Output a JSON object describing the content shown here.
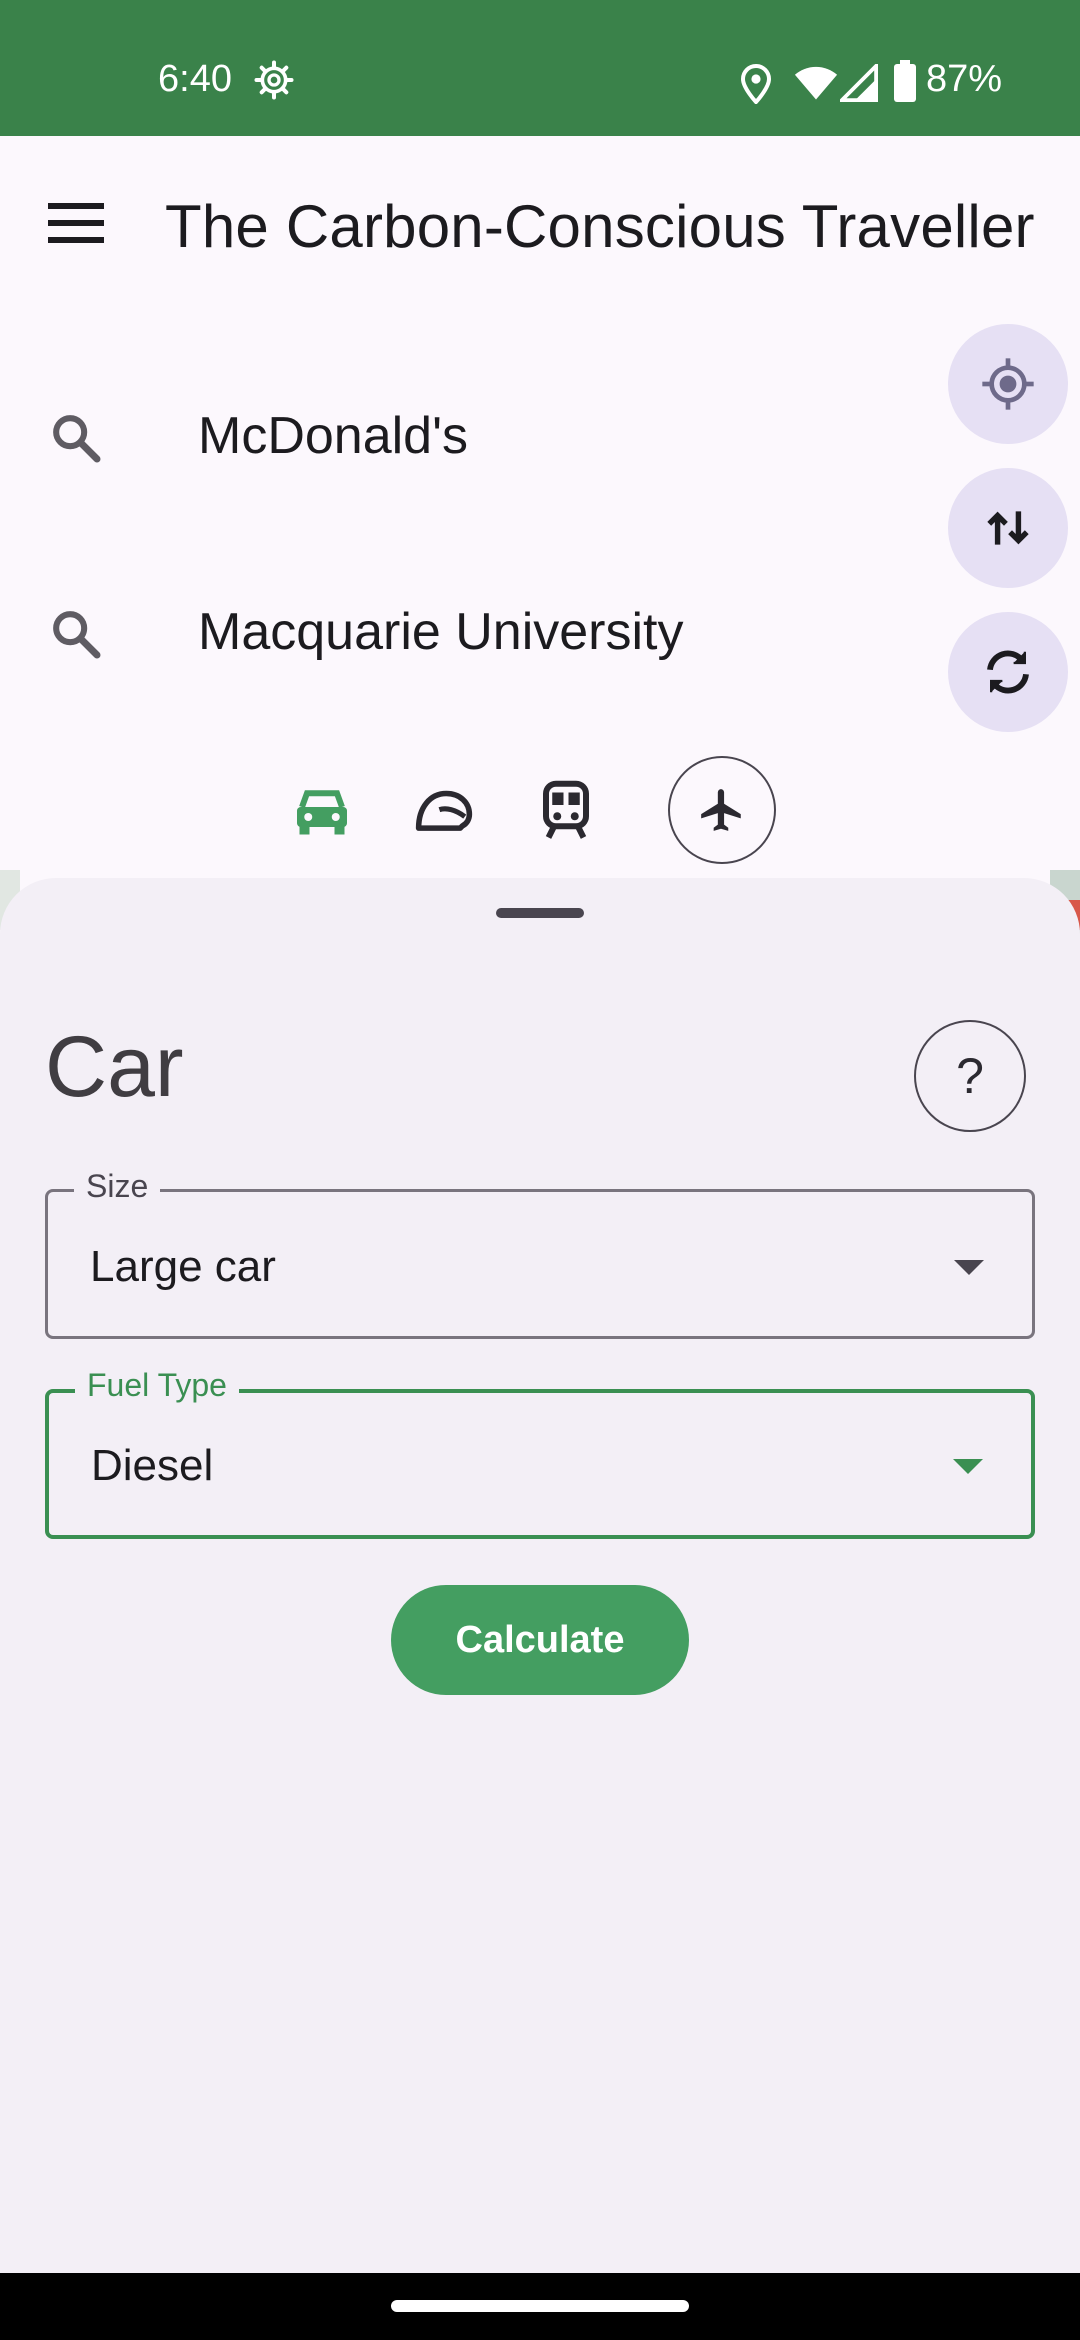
{
  "status_bar": {
    "time": "6:40",
    "battery": "87%",
    "icons": [
      "settings-gear-icon",
      "location-icon",
      "wifi-icon",
      "cell-signal-icon",
      "battery-icon"
    ]
  },
  "app_bar": {
    "title": "The Carbon-Conscious Traveller",
    "menu_icon": "hamburger-menu-icon"
  },
  "search": {
    "origin": "McDonald's",
    "destination": "Macquarie University"
  },
  "fabs": [
    "my-location-icon",
    "swap-vertical-icon",
    "refresh-icon"
  ],
  "transport_modes": [
    {
      "name": "car",
      "selected": true
    },
    {
      "name": "motorcycle",
      "selected": false
    },
    {
      "name": "train",
      "selected": false
    },
    {
      "name": "flight",
      "selected": false
    }
  ],
  "sheet": {
    "title": "Car",
    "help_label": "?",
    "size": {
      "label": "Size",
      "value": "Large car"
    },
    "fuel": {
      "label": "Fuel Type",
      "value": "Diesel"
    },
    "calculate_label": "Calculate"
  },
  "colors": {
    "status_bar": "#3a824a",
    "accent": "#3a8f52",
    "button": "#449e61",
    "fab": "#e6e0f4",
    "sheet": "#f3eff6"
  }
}
